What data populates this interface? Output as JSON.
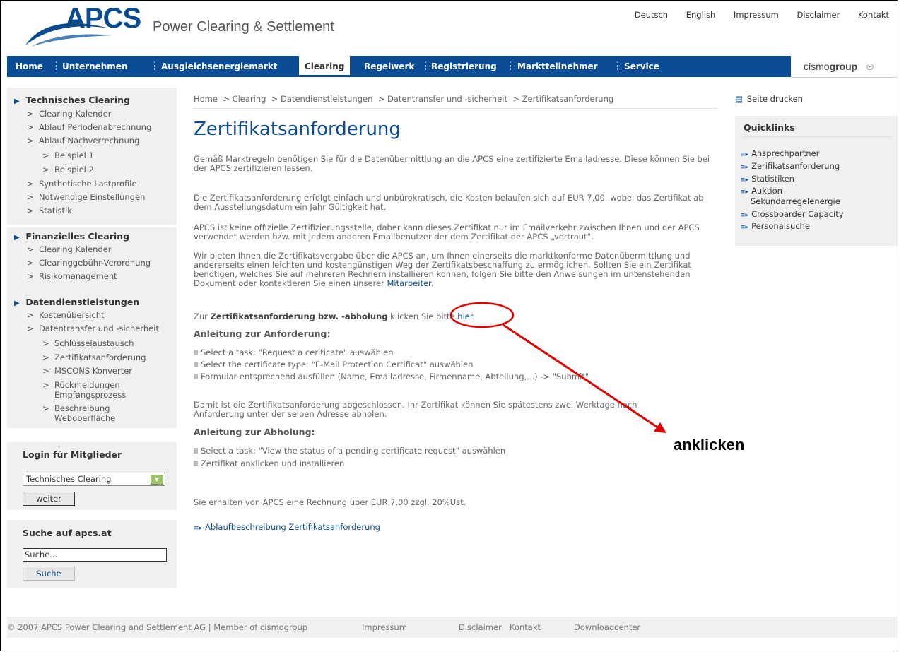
{
  "header": {
    "logo_text": "APCS",
    "tagline": "Power Clearing & Settlement",
    "top_links": [
      "Deutsch",
      "English",
      "Impressum",
      "Disclaimer",
      "Kontakt"
    ]
  },
  "nav": {
    "items": [
      "Home",
      "Unternehmen",
      "Ausgleichsenergiemarkt",
      "Clearing",
      "Regelwerk",
      "Registrierung",
      "Marktteilnehmer",
      "Service"
    ],
    "brand_light": "cismo",
    "brand_bold": "group"
  },
  "sidebar": {
    "technisches": {
      "title": "Technisches Clearing",
      "items": [
        "Clearing Kalender",
        "Ablauf Periodenabrechnung",
        "Ablauf Nachverrechnung",
        "Beispiel 1",
        "Beispiel 2",
        "Synthetische Lastprofile",
        "Notwendige Einstellungen",
        "Statistik"
      ]
    },
    "finanzielles": {
      "title": "Finanzielles Clearing",
      "items": [
        "Clearing Kalender",
        "Clearinggebühr-Verordnung",
        "Risikomanagement"
      ]
    },
    "daten": {
      "title": "Datendienstleistungen",
      "items": [
        "Kostenübersicht",
        "Datentransfer und -sicherheit",
        "Schlüsselaustausch",
        "Zertifikatsanforderung",
        "MSCONS Konverter",
        "Rückmeldungen",
        "Empfangsprozess",
        "Beschreibung",
        "Weboberfläche"
      ]
    },
    "login": {
      "title": "Login für Mitglieder",
      "select_value": "Technisches Clearing",
      "button": "weiter"
    },
    "search": {
      "title": "Suche auf apcs.at",
      "input_value": "Suche...",
      "button": "Suche"
    }
  },
  "main": {
    "breadcrumb": [
      "Home",
      "Clearing",
      "Datendienstleistungen",
      "Datentransfer und -sicherheit",
      "Zertifikatsanforderung"
    ],
    "title": "Zertifikatsanforderung",
    "p1": "Gemäß Marktregeln benötigen Sie für die Datenübermittlung an die APCS eine zertifizierte Emailadresse. Diese können Sie bei der APCS zertifizieren lassen.",
    "p2": "Die Zertifikatsanforderung erfolgt einfach und unbürokratisch, die Kosten belaufen sich auf EUR 7,00, wobei das Zertifikat ab dem Ausstellungsdatum ein Jahr Gültigkeit hat.",
    "p3": "APCS ist keine offizielle Zertifizierungsstelle, daher kann dieses Zertifikat nur im Emailverkehr zwischen Ihnen und der APCS verwendet werden bzw. mit jedem anderen Emailbenutzer der dem Zertifikat der APCS „vertraut“.",
    "p4": "Wir bieten Ihnen die Zertifikatsvergabe über die APCS an, um Ihnen einerseits die marktkonforme Datenübermittlung und andererseits einen leichten und kostengünstigen Weg der Zertifikatsbeschaffung zu ermöglichen. Sollten Sie ein Zertifikat benötigen, welches Sie auf mehreren Rechnern installieren können, folgen Sie bitte den Anweisungen im untenstehenden Dokument oder kontaktieren Sie einen unserer",
    "p4_link": "Mitarbeiter",
    "p5_pre": "Zur ",
    "p5_bold": "Zertifikatsanforderung bzw. -abholung",
    "p5_mid": " klicken Sie bitte ",
    "p5_link": "hier",
    "h_anforderung": "Anleitung zur Anforderung:",
    "steps_anforderung": [
      "Select a task: \"Request a ceriticate\" auswählen",
      "Select the certificate type: \"E-Mail Protection Certificat\" auswählen",
      "Formular entsprechend ausfüllen (Name, Emailadresse, Firmenname, Abteilung,...) -> \"Submit\""
    ],
    "p6": "Damit ist die Zertifikatsanforderung abgeschlossen. Ihr Zertifikat können Sie spätestens zwei Werktage nach Anforderung unter der selben Adresse abholen.",
    "h_abholung": "Anleitung zur Abholung:",
    "steps_abholung": [
      "Select a task: \"View the status of a pending certificate request\" auswählen",
      "Zertifikat anklicken und installieren"
    ],
    "p7": "Sie erhalten von APCS eine Rechnung über EUR 7,00 zzgl. 20%Ust.",
    "doc_link": "Ablaufbeschreibung Zertifikatsanforderung",
    "annotation": "anklicken"
  },
  "right": {
    "print": "Seite drucken",
    "quicklinks_title": "Quicklinks",
    "quicklinks": [
      "Ansprechpartner",
      "Zerifikatsanforderung",
      "Statistiken",
      "Auktion",
      "Sekundärregelenergie",
      "Crossboarder Capacity",
      "Personalsuche"
    ]
  },
  "footer": {
    "copyright": "© 2007 APCS Power Clearing and Settlement AG | Member of cismogroup",
    "links": [
      "Impressum",
      "Disclaimer",
      "Kontakt",
      "Downloadcenter"
    ]
  },
  "colors": {
    "nav_blue": "#0a4c96",
    "annotation_red": "#e00000"
  }
}
